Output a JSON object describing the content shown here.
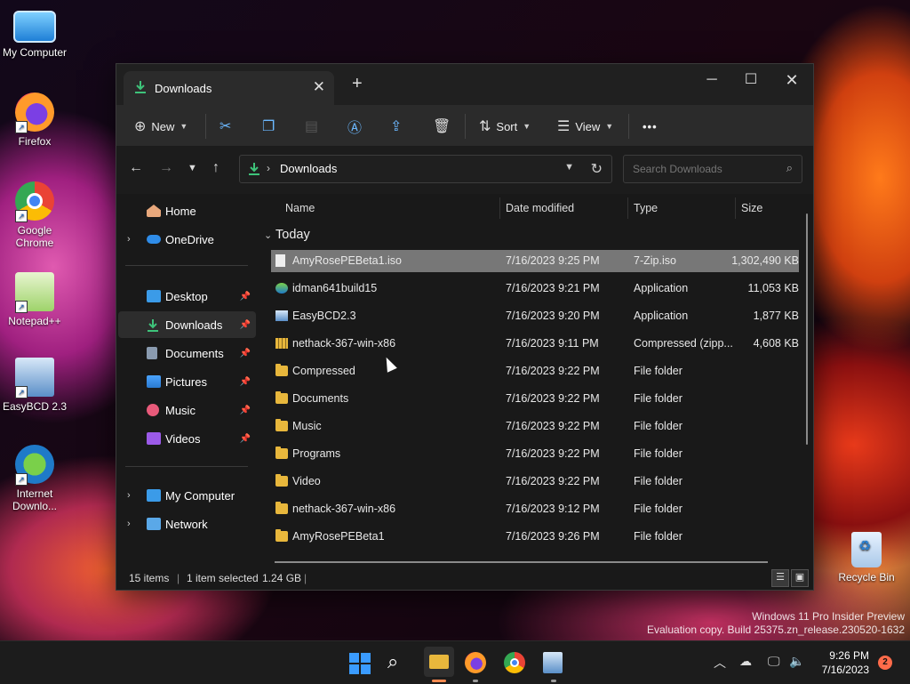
{
  "desktop": {
    "icons": [
      {
        "label": "My Computer"
      },
      {
        "label": "Firefox"
      },
      {
        "label": "Google Chrome"
      },
      {
        "label": "Notepad++"
      },
      {
        "label": "EasyBCD 2.3"
      },
      {
        "label": "Internet Downlo..."
      },
      {
        "label": "Recycle Bin"
      }
    ],
    "watermark": {
      "line1": "Windows 11 Pro Insider Preview",
      "line2": "Evaluation copy. Build 25375.zn_release.230520-1632"
    }
  },
  "explorer": {
    "tab_title": "Downloads",
    "toolbar": {
      "new_label": "New",
      "sort_label": "Sort",
      "view_label": "View",
      "more_label": "•••"
    },
    "address": {
      "crumb": "Downloads",
      "search_placeholder": "Search Downloads"
    },
    "sidebar": {
      "items": [
        {
          "label": "Home"
        },
        {
          "label": "OneDrive"
        },
        {
          "label": "Desktop"
        },
        {
          "label": "Downloads"
        },
        {
          "label": "Documents"
        },
        {
          "label": "Pictures"
        },
        {
          "label": "Music"
        },
        {
          "label": "Videos"
        },
        {
          "label": "My Computer"
        },
        {
          "label": "Network"
        }
      ]
    },
    "columns": {
      "name": "Name",
      "date": "Date modified",
      "type": "Type",
      "size": "Size"
    },
    "group_label": "Today",
    "files": [
      {
        "name": "AmyRosePEBeta1.iso",
        "date": "7/16/2023 9:25 PM",
        "type": "7-Zip.iso",
        "size": "1,302,490 KB"
      },
      {
        "name": "idman641build15",
        "date": "7/16/2023 9:21 PM",
        "type": "Application",
        "size": "11,053 KB"
      },
      {
        "name": "EasyBCD2.3",
        "date": "7/16/2023 9:20 PM",
        "type": "Application",
        "size": "1,877 KB"
      },
      {
        "name": "nethack-367-win-x86",
        "date": "7/16/2023 9:11 PM",
        "type": "Compressed (zipp...",
        "size": "4,608 KB"
      },
      {
        "name": "Compressed",
        "date": "7/16/2023 9:22 PM",
        "type": "File folder",
        "size": ""
      },
      {
        "name": "Documents",
        "date": "7/16/2023 9:22 PM",
        "type": "File folder",
        "size": ""
      },
      {
        "name": "Music",
        "date": "7/16/2023 9:22 PM",
        "type": "File folder",
        "size": ""
      },
      {
        "name": "Programs",
        "date": "7/16/2023 9:22 PM",
        "type": "File folder",
        "size": ""
      },
      {
        "name": "Video",
        "date": "7/16/2023 9:22 PM",
        "type": "File folder",
        "size": ""
      },
      {
        "name": "nethack-367-win-x86",
        "date": "7/16/2023 9:12 PM",
        "type": "File folder",
        "size": ""
      },
      {
        "name": "AmyRosePEBeta1",
        "date": "7/16/2023 9:26 PM",
        "type": "File folder",
        "size": ""
      }
    ],
    "status": {
      "items": "15 items",
      "selected": "1 item selected",
      "size": "1.24 GB"
    }
  },
  "taskbar": {
    "time": "9:26 PM",
    "date": "7/16/2023",
    "notification_count": "2"
  },
  "colors": {
    "accent": "#6cb8ff",
    "download_green": "#3ec37a",
    "folder": "#e8b73c",
    "notification": "#ff6b4a"
  }
}
